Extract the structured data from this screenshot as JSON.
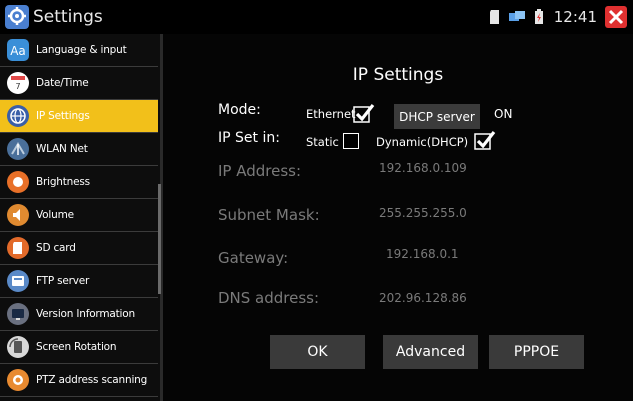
{
  "app": {
    "title": "Settings"
  },
  "status": {
    "time": "12:41"
  },
  "sidebar": {
    "items": [
      {
        "label": "Language & input",
        "icon": "language-icon"
      },
      {
        "label": "Date/Time",
        "icon": "calendar-icon"
      },
      {
        "label": "IP Settings",
        "icon": "globe-icon",
        "active": true
      },
      {
        "label": "WLAN Net",
        "icon": "wifi-icon"
      },
      {
        "label": "Brightness",
        "icon": "brightness-icon"
      },
      {
        "label": "Volume",
        "icon": "volume-icon"
      },
      {
        "label": "SD card",
        "icon": "sd-card-icon"
      },
      {
        "label": "FTP server",
        "icon": "ftp-icon"
      },
      {
        "label": "Version Information",
        "icon": "monitor-icon"
      },
      {
        "label": "Screen Rotation",
        "icon": "rotation-icon"
      },
      {
        "label": "PTZ address scanning",
        "icon": "camera-icon"
      }
    ]
  },
  "main": {
    "title": "IP Settings",
    "mode_label": "Mode:",
    "ethernet_label": "Ethernet",
    "ethernet_checked": true,
    "dhcp_server_label": "DHCP server",
    "dhcp_server_state": "ON",
    "ipset_label": "IP Set in:",
    "static_label": "Static",
    "static_checked": false,
    "dynamic_label": "Dynamic(DHCP)",
    "dynamic_checked": true,
    "fields": [
      {
        "label": "IP Address:",
        "value": "192.168.0.109"
      },
      {
        "label": "Subnet Mask:",
        "value": "255.255.255.0"
      },
      {
        "label": "Gateway:",
        "value": "192.168.0.1"
      },
      {
        "label": "DNS address:",
        "value": "202.96.128.86"
      }
    ],
    "buttons": {
      "ok": "OK",
      "advanced": "Advanced",
      "pppoe": "PPPOE"
    }
  },
  "colors": {
    "accent": "#f2c01a",
    "background": "#000000",
    "button": "#3a3a3a",
    "muted_text": "#7a7a7a",
    "close": "#e03030"
  }
}
